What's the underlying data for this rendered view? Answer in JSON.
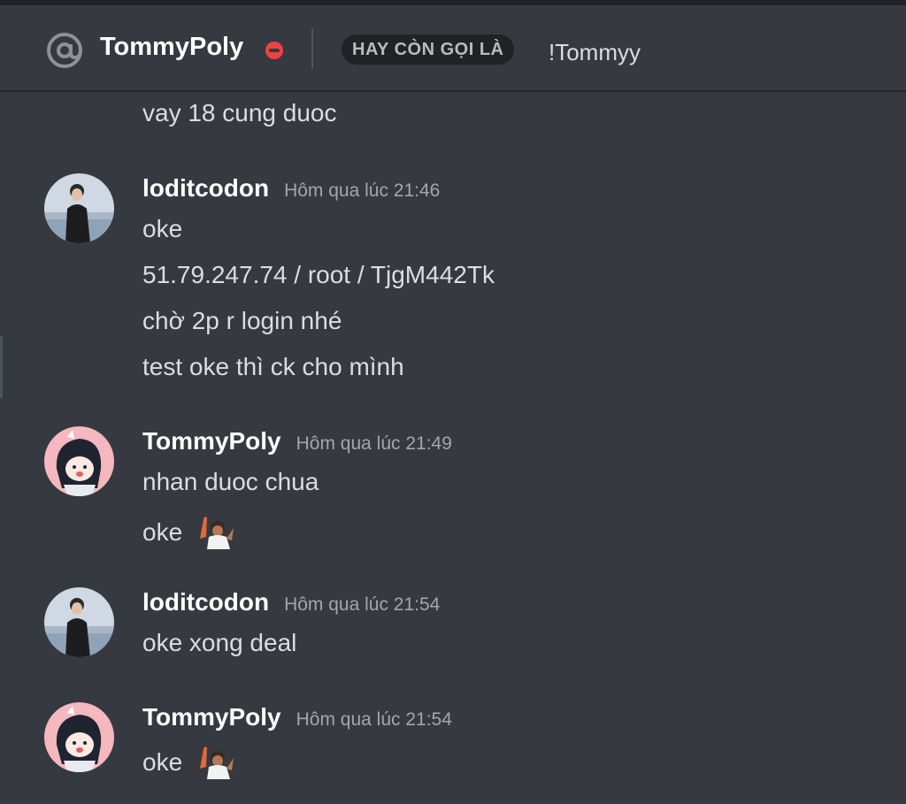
{
  "header": {
    "icon": "at-sign-icon",
    "name": "TommyPoly",
    "status_icon": "do-not-disturb-icon",
    "status_color": "#ed4245",
    "aka_label": "HAY CÒN GỌI LÀ",
    "aka_name": "!Tommyy"
  },
  "messages": [
    {
      "type": "continuation",
      "text": "vay 18 cung duoc"
    },
    {
      "type": "group",
      "author": "loditcodon",
      "timestamp": "Hôm qua lúc 21:46",
      "avatar": "user-photo-avatar",
      "lines": [
        "oke",
        "51.79.247.74 / root / TjgM442Tk",
        "chờ 2p r login nhé",
        "test oke thì ck cho mình"
      ]
    },
    {
      "type": "group",
      "author": "TommyPoly",
      "timestamp": "Hôm qua lúc 21:49",
      "avatar": "anime-girl-avatar",
      "lines": [
        "nhan duoc chua",
        "oke"
      ],
      "emoji": "waving-character-emoji"
    },
    {
      "type": "group",
      "author": "loditcodon",
      "timestamp": "Hôm qua lúc 21:54",
      "avatar": "user-photo-avatar",
      "lines": [
        "oke xong deal"
      ]
    },
    {
      "type": "group",
      "author": "TommyPoly",
      "timestamp": "Hôm qua lúc 21:54",
      "avatar": "anime-girl-avatar",
      "lines": [
        "oke"
      ],
      "emoji": "waving-character-emoji"
    }
  ],
  "colors": {
    "background": "#36393f",
    "header_bg": "#36393f",
    "badge_bg": "#202225",
    "text": "#dcddde",
    "author": "#ffffff",
    "timestamp": "#a3a6aa"
  }
}
